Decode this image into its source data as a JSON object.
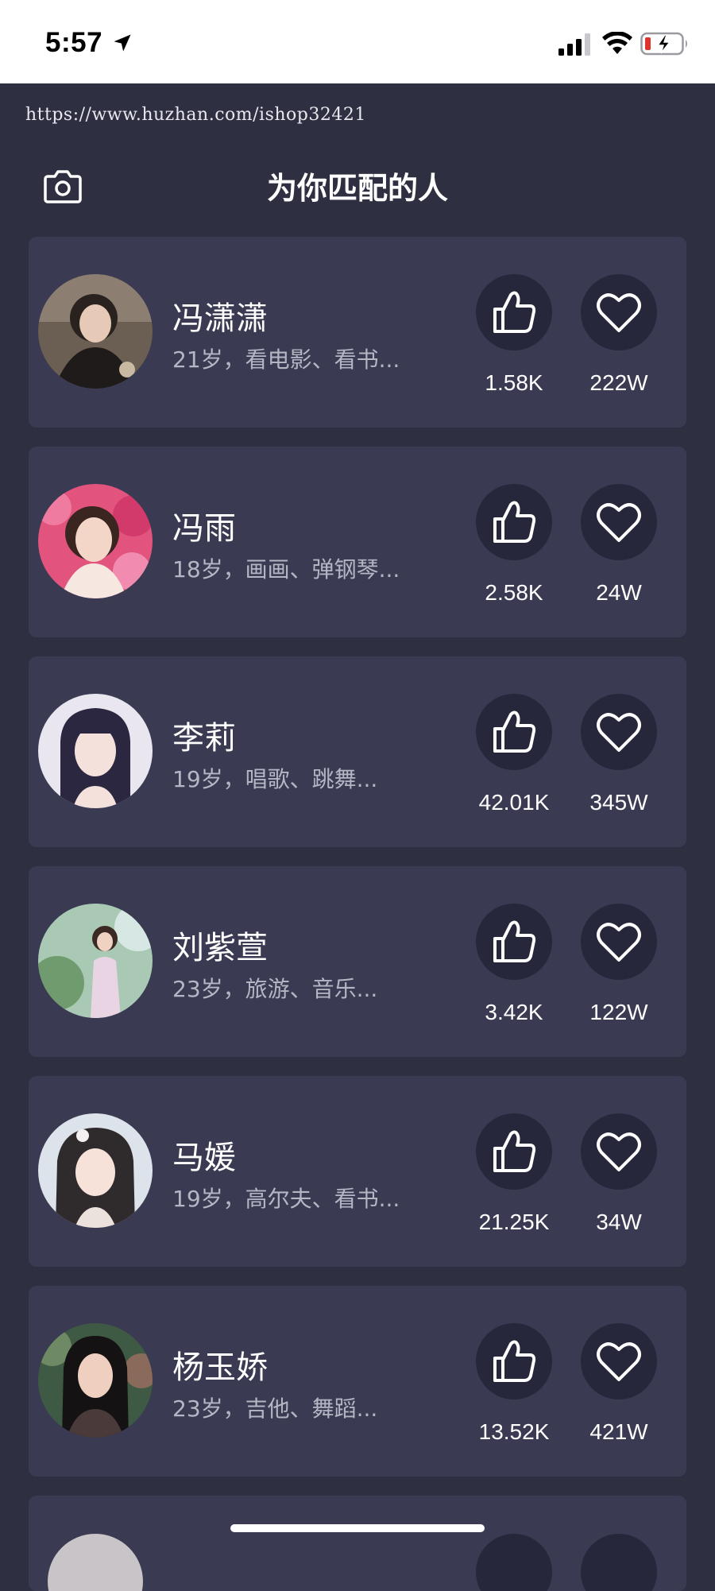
{
  "status_bar": {
    "time": "5:57",
    "icons": [
      "location-arrow-icon",
      "cellular-signal-icon",
      "wifi-icon",
      "battery-charging-icon"
    ]
  },
  "watermark": "https://www.huzhan.com/ishop32421",
  "header": {
    "title": "为你匹配的人",
    "camera_icon": "camera-icon"
  },
  "matches": [
    {
      "name": "冯潇潇",
      "desc": "21岁，看电影、看书...",
      "likes": "1.58K",
      "favorites": "222W"
    },
    {
      "name": "冯雨",
      "desc": "18岁，画画、弹钢琴...",
      "likes": "2.58K",
      "favorites": "24W"
    },
    {
      "name": "李莉",
      "desc": "19岁，唱歌、跳舞...",
      "likes": "42.01K",
      "favorites": "345W"
    },
    {
      "name": "刘紫萱",
      "desc": "23岁，旅游、音乐...",
      "likes": "3.42K",
      "favorites": "122W"
    },
    {
      "name": "马媛",
      "desc": "19岁，高尔夫、看书...",
      "likes": "21.25K",
      "favorites": "34W"
    },
    {
      "name": "杨玉娇",
      "desc": "23岁，吉他、舞蹈...",
      "likes": "13.52K",
      "favorites": "421W"
    }
  ],
  "colors": {
    "background": "#2e2f41",
    "card": "#3a3b52",
    "icon_button": "#26273a",
    "secondary_text": "#b5b6c4"
  }
}
